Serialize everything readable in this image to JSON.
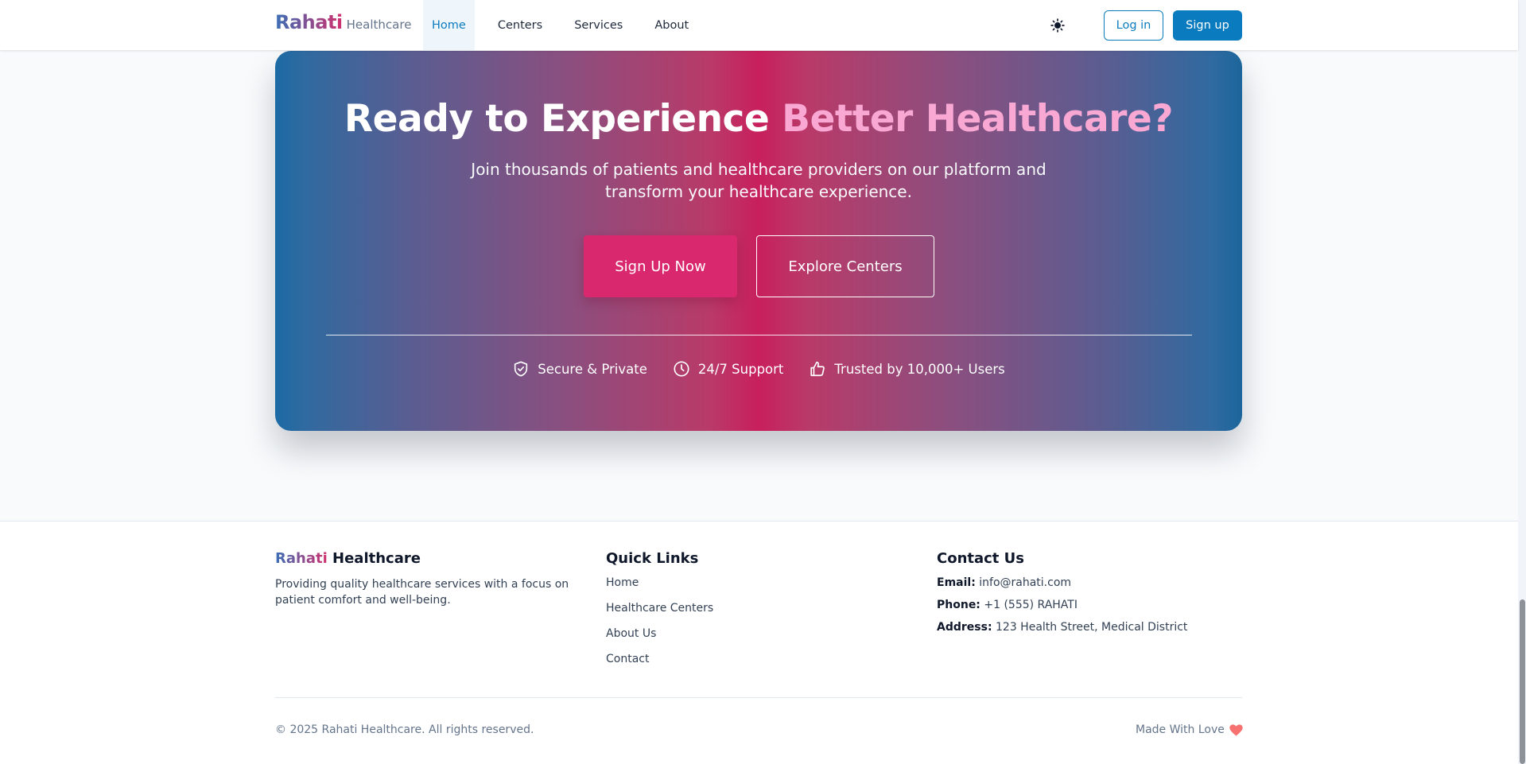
{
  "header": {
    "brand_name": "Rahati",
    "brand_suffix": "Healthcare",
    "nav": [
      {
        "label": "Home",
        "active": true
      },
      {
        "label": "Centers",
        "active": false
      },
      {
        "label": "Services",
        "active": false
      },
      {
        "label": "About",
        "active": false
      }
    ],
    "theme_icon": "sun-icon",
    "login_label": "Log in",
    "signup_label": "Sign up"
  },
  "cta": {
    "title_prefix": "Ready to Experience",
    "title_highlight": "Better Healthcare?",
    "subtitle_line1": "Join thousands of patients and healthcare providers on our platform and",
    "subtitle_line2": "transform your healthcare experience.",
    "primary_button": "Sign Up Now",
    "secondary_button": "Explore Centers",
    "features": [
      {
        "icon": "shield-check-icon",
        "label": "Secure & Private"
      },
      {
        "icon": "clock-icon",
        "label": "24/7 Support"
      },
      {
        "icon": "thumbs-up-icon",
        "label": "Trusted by 10,000+ Users"
      }
    ]
  },
  "footer": {
    "brand_name": "Rahati",
    "brand_suffix": "Healthcare",
    "description": "Providing quality healthcare services with a focus on patient comfort and well-being.",
    "quick_links_title": "Quick Links",
    "quick_links": [
      "Home",
      "Healthcare Centers",
      "About Us",
      "Contact"
    ],
    "contact_title": "Contact Us",
    "contact": [
      {
        "label": "Email:",
        "value": "info@rahati.com"
      },
      {
        "label": "Phone:",
        "value": "+1 (555) RAHATI"
      },
      {
        "label": "Address:",
        "value": "123 Health Street, Medical District"
      }
    ],
    "copyright": "© 2025 Rahati Healthcare. All rights reserved.",
    "made_with": "Made With Love",
    "heart_icon": "heart-icon"
  },
  "colors": {
    "primary": "#0b7bbf",
    "accent_pink": "#d9286e",
    "highlight_pink": "#f9a8d4",
    "gradient_blue": "#1c6aa4",
    "gradient_magenta": "#c81f5d",
    "heart": "#f87171"
  }
}
